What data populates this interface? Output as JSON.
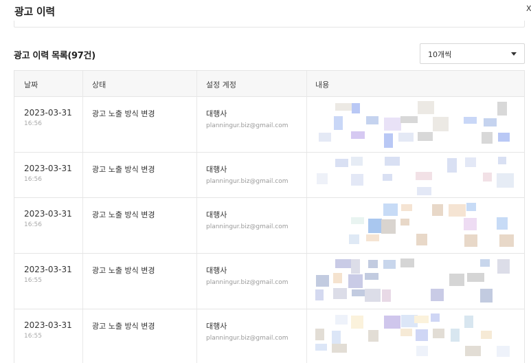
{
  "header": {
    "title": "광고 이력",
    "close_glyph": "X"
  },
  "list": {
    "title": "광고 이력 목록(97건)"
  },
  "page_size_select": {
    "value": "10개씩",
    "icon": "caret-down-icon"
  },
  "table": {
    "columns": [
      "날짜",
      "상태",
      "설정 계정",
      "내용"
    ],
    "rows": [
      {
        "date": "2023-03-31",
        "time": "16:56",
        "status": "광고 노출 방식 변경",
        "account": "대행사",
        "email": "planningur.biz@gmail.com"
      },
      {
        "date": "2023-03-31",
        "time": "16:56",
        "status": "광고 노출 방식 변경",
        "account": "대행사",
        "email": "planningur.biz@gmail.com"
      },
      {
        "date": "2023-03-31",
        "time": "16:56",
        "status": "광고 노출 방식 변경",
        "account": "대행사",
        "email": "planningur.biz@gmail.com"
      },
      {
        "date": "2023-03-31",
        "time": "16:55",
        "status": "광고 노출 방식 변경",
        "account": "대행사",
        "email": "planningur.biz@gmail.com"
      },
      {
        "date": "2023-03-31",
        "time": "16:55",
        "status": "광고 노출 방식 변경",
        "account": "대행사",
        "email": "planningur.biz@gmail.com"
      }
    ]
  },
  "colors": {
    "header_bg": "#f7f7f7",
    "border": "#e5e5e5",
    "muted_text": "#a8a8a8"
  }
}
